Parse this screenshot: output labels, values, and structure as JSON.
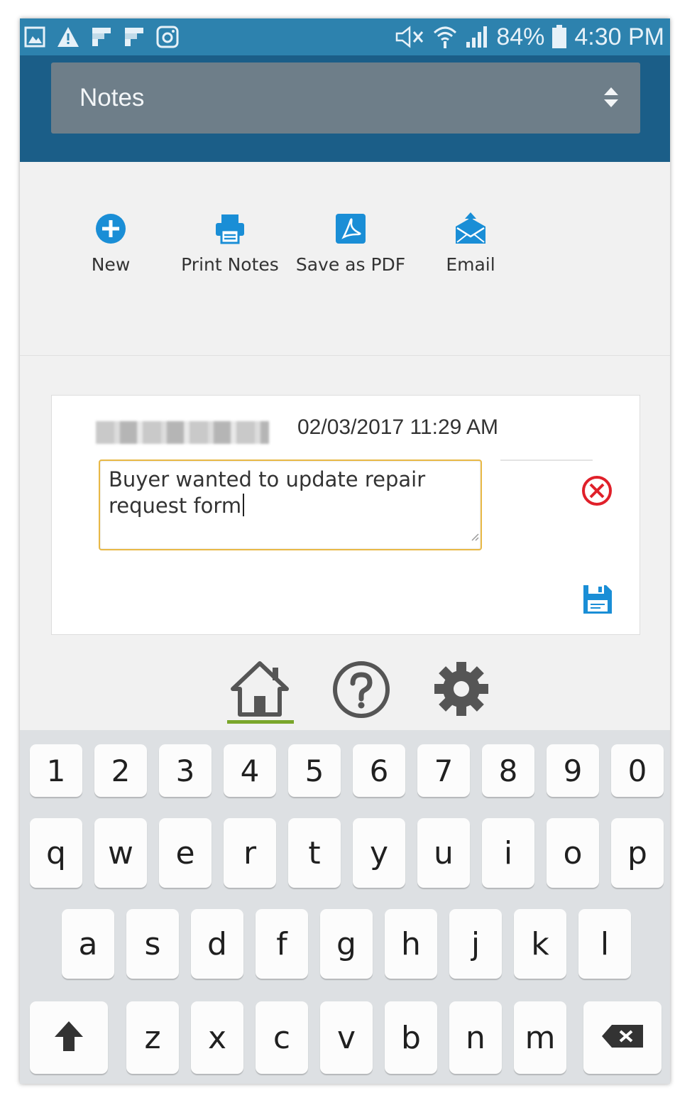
{
  "status_bar": {
    "battery": "84%",
    "time": "4:30 PM",
    "left_icons": [
      "gallery-icon",
      "warning-icon",
      "flipboard-icon",
      "flipboard-icon",
      "instagram-icon"
    ],
    "right_icons": [
      "mute-icon",
      "wifi-icon",
      "signal-icon",
      "battery-icon"
    ]
  },
  "header": {
    "section_select": "Notes"
  },
  "toolbar": {
    "new_label": "New",
    "print_label": "Print Notes",
    "pdf_label": "Save as PDF",
    "email_label": "Email"
  },
  "note": {
    "author": "",
    "timestamp": "02/03/2017 11:29 AM",
    "text_line1": "Buyer wanted to update repair",
    "text_line2": "request form"
  },
  "bottom_nav": {
    "items": [
      "home-icon",
      "help-icon",
      "settings-icon"
    ],
    "active": "home"
  },
  "keyboard": {
    "number_row": [
      "1",
      "2",
      "3",
      "4",
      "5",
      "6",
      "7",
      "8",
      "9",
      "0"
    ],
    "row1": [
      "q",
      "w",
      "e",
      "r",
      "t",
      "y",
      "u",
      "i",
      "o",
      "p"
    ],
    "row2": [
      "a",
      "s",
      "d",
      "f",
      "g",
      "h",
      "j",
      "k",
      "l"
    ],
    "row3": [
      "z",
      "x",
      "c",
      "v",
      "b",
      "n",
      "m"
    ]
  },
  "colors": {
    "status_bar": "#2d82ae",
    "app_bar": "#1b5e88",
    "accent_blue": "#1a8ed6",
    "delete_red": "#e0202a",
    "focus_border": "#e8b845",
    "active_nav": "#7aa62a"
  }
}
